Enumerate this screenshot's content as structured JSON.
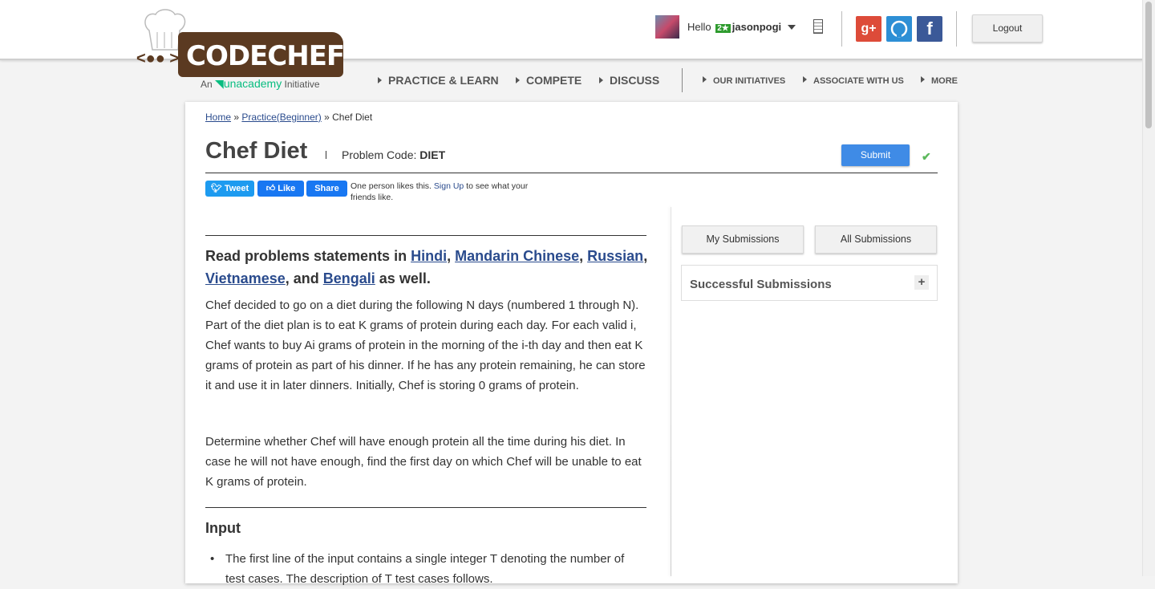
{
  "header": {
    "logo_text": "CODECHEF",
    "logo_sub_prefix": "An",
    "logo_sub_brand": "unacademy",
    "logo_sub_suffix": "Initiative",
    "greeting": "Hello",
    "rating_badge": "2★",
    "username": "jasonpogi",
    "logout_label": "Logout",
    "social_icons": [
      "google-plus-icon",
      "github-icon",
      "facebook-icon"
    ]
  },
  "nav": {
    "items": [
      "PRACTICE & LEARN",
      "COMPETE",
      "DISCUSS",
      "OUR INITIATIVES",
      "ASSOCIATE WITH US",
      "MORE"
    ]
  },
  "breadcrumb": {
    "home": "Home",
    "practice": "Practice(Beginner)",
    "current": "Chef Diet",
    "separator": "»"
  },
  "problem": {
    "title": "Chef Diet",
    "code_label": "Problem Code:",
    "code": "DIET",
    "submit_label": "Submit"
  },
  "social_share": {
    "tweet": "Tweet",
    "like": "Like",
    "share": "Share",
    "likes_text_1": "One person likes this.",
    "sign_up": "Sign Up",
    "likes_text_2": "to see what your friends like."
  },
  "languages": {
    "prefix": "Read problems statements in",
    "hindi": "Hindi",
    "mandarin": "Mandarin Chinese",
    "russian": "Russian",
    "vietnamese": "Vietnamese",
    "and": ", and",
    "bengali": "Bengali",
    "suffix": "as well."
  },
  "statement": {
    "p1": "Chef decided to go on a diet during the following N days (numbered 1 through N). Part of the diet plan is to eat K grams of protein during each day. For each valid i, Chef wants to buy Ai grams of protein in the morning of the i-th day and then eat K grams of protein as part of his dinner. If he has any protein remaining, he can store it and use it in later dinners. Initially, Chef is storing 0 grams of protein.",
    "p2": "Determine whether Chef will have enough protein all the time during his diet. In case he will not have enough, find the first day on which Chef will be unable to eat K grams of protein.",
    "input_heading": "Input",
    "input_bullet_1": "The first line of the input contains a single integer T denoting the number of test cases. The description of T test cases follows."
  },
  "sidebar": {
    "my_submissions": "My Submissions",
    "all_submissions": "All Submissions",
    "successful_submissions": "Successful Submissions"
  }
}
